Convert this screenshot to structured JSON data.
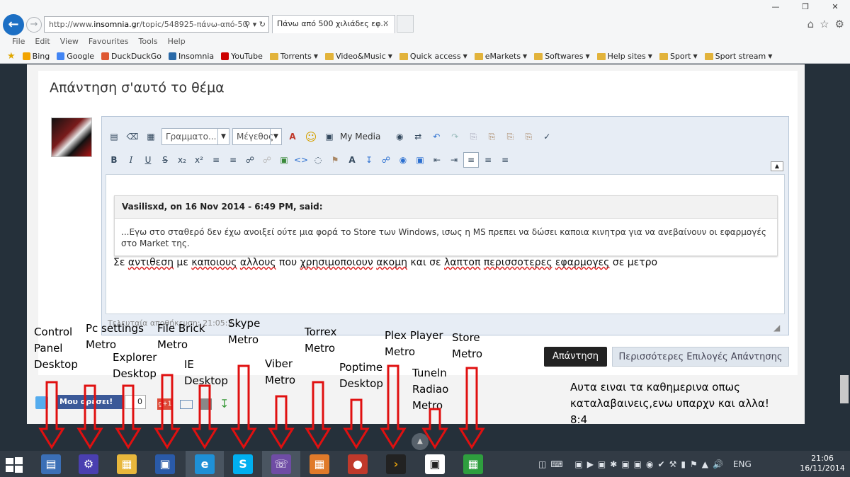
{
  "browser": {
    "url_prefix": "http://www.",
    "url_domain": "insomnia.gr",
    "url_rest": "/topic/548925-πάνω-από-50",
    "tab_title": "Πάνω από 500 χιλιάδες εφ...",
    "tab_close": "×",
    "menu": [
      "File",
      "Edit",
      "View",
      "Favourites",
      "Tools",
      "Help"
    ],
    "favourites": [
      {
        "label": "Bing",
        "icon": "bing-icon",
        "folder": false
      },
      {
        "label": "Google",
        "icon": "google-icon",
        "folder": false
      },
      {
        "label": "DuckDuckGo",
        "icon": "duckduckgo-icon",
        "folder": false
      },
      {
        "label": "Insomnia",
        "icon": "insomnia-icon",
        "folder": false
      },
      {
        "label": "YouTube",
        "icon": "youtube-icon",
        "folder": false
      },
      {
        "label": "Torrents",
        "icon": "folder-icon",
        "folder": true
      },
      {
        "label": "Video&Music",
        "icon": "folder-icon",
        "folder": true
      },
      {
        "label": "Quick access",
        "icon": "folder-icon",
        "folder": true
      },
      {
        "label": "eMarkets",
        "icon": "folder-icon",
        "folder": true
      },
      {
        "label": "Softwares",
        "icon": "folder-icon",
        "folder": true
      },
      {
        "label": "Help sites",
        "icon": "folder-icon",
        "folder": true
      },
      {
        "label": "Sport",
        "icon": "folder-icon",
        "folder": true
      },
      {
        "label": "Sport stream",
        "icon": "folder-icon",
        "folder": true
      }
    ]
  },
  "page": {
    "heading": "Απάντηση σ'αυτό το θέμα",
    "editor": {
      "font_select": "Γραμματο...",
      "size_select": "Μέγεθος",
      "my_media": "My Media",
      "quote_header": "Vasilisxd, on 16 Nov 2014 - 6:49 PM, said:",
      "quote_body": "...Εγω στο σταθερό δεν έχω ανοιξεί ούτε μια φορά το Store των Windows, ισως η MS πρεπει να δώσει καποια κινητρα για να ανεβαίνουν οι εφαρμογές στο Market της.",
      "reply_words": [
        "Σε",
        " ",
        "αντιθεση",
        " με ",
        "καποιους",
        " ",
        "αλλους",
        " που ",
        "χρησιμοποιουν",
        " ",
        "ακομη",
        " και σε ",
        "λαπτοπ",
        " ",
        "περισσοτερες",
        " ",
        "εφαρμογες",
        " σε ",
        "μετρο"
      ],
      "last_saved": "Τελευταία αποθήκευση: 21:05:2"
    },
    "reply_button": "Απάντηση",
    "more_options_button": "Περισσότερες Επιλογές Απάντησης",
    "fb_like": "Μου αρέσει!",
    "fb_count": "0",
    "gplus": "g+1"
  },
  "annotations": [
    {
      "lines": [
        "Control",
        "Panel",
        "Desktop"
      ]
    },
    {
      "lines": [
        "Pc settings",
        "Metro"
      ]
    },
    {
      "lines": [
        "Explorer",
        "Desktop"
      ]
    },
    {
      "lines": [
        "File Brick",
        "Metro"
      ]
    },
    {
      "lines": [
        "IE",
        "Desktop"
      ]
    },
    {
      "lines": [
        "Skype",
        "Metro"
      ]
    },
    {
      "lines": [
        "Viber",
        "Metro"
      ]
    },
    {
      "lines": [
        "Torrex",
        "Metro"
      ]
    },
    {
      "lines": [
        "Poptime",
        "Desktop"
      ]
    },
    {
      "lines": [
        "Plex Player",
        "Metro"
      ]
    },
    {
      "lines": [
        "Tuneln",
        "Radiao",
        "Metro"
      ]
    },
    {
      "lines": [
        "Store",
        "Metro"
      ]
    }
  ],
  "note": {
    "lines": [
      "Αυτα ειναι τα καθημερινα οπως",
      "καταλαβαινεις,ενω υπαρχν και αλλα!",
      "8:4"
    ]
  },
  "taskbar": {
    "apps": [
      {
        "name": "control-panel",
        "color": "#3b6fb6"
      },
      {
        "name": "pc-settings",
        "color": "#4a3fb0"
      },
      {
        "name": "file-explorer",
        "color": "#e8b73c"
      },
      {
        "name": "file-brick",
        "color": "#2a5aa8"
      },
      {
        "name": "internet-explorer",
        "color": "#1e90d6"
      },
      {
        "name": "skype",
        "color": "#00aff0"
      },
      {
        "name": "viber",
        "color": "#6f4ca5"
      },
      {
        "name": "torrex",
        "color": "#e07a2a"
      },
      {
        "name": "poptime",
        "color": "#c0392b"
      },
      {
        "name": "plex",
        "color": "#222222"
      },
      {
        "name": "tunein-radio",
        "color": "#ffffff"
      },
      {
        "name": "store",
        "color": "#2e9e3e"
      }
    ],
    "lang": "ENG",
    "time": "21:06",
    "date": "16/11/2014"
  }
}
